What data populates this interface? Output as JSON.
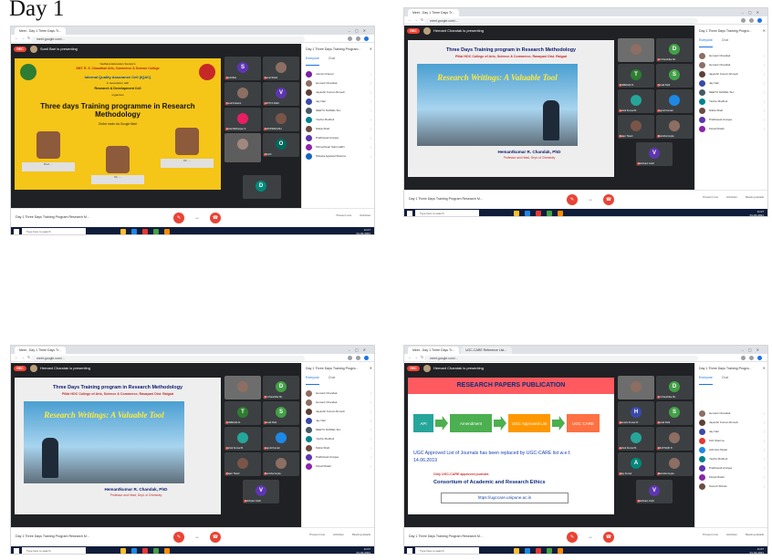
{
  "heading": "Day 1",
  "screens": [
    {
      "tabs": [
        "Meet - Day 1 Three Days Tr...",
        ""
      ],
      "url": "meet.google.com/...",
      "presenting": "Sunil Bari is presenting",
      "meeting_title": "Day 1 Three Days Training Program Research M...",
      "panel_title": "Day 1 Three Days Training Program...",
      "panel_tabs": [
        "Everyone",
        "Chat"
      ],
      "slide_kind": "poster",
      "slide": {
        "top_lines": [
          "Sadhana Education Society's",
          "SMT. R. S. Chaudhari Arts, Commerce & Science College",
          "Internal Quality Assurance Cell (IQAC)",
          "in association with",
          "Research & Development Cell",
          "organizes"
        ],
        "headline": "Three days Training programme in Research Methodology",
        "date_line": "Online mode via Google Meet",
        "speaker_captions": [
          "Prof. ...",
          "Dr. ...",
          "Dr. ..."
        ]
      },
      "tiles": [
        "Sunil Bari",
        "Sonal Shahi",
        "Kunal Kukarni",
        "UDITYA NAIK",
        "Anita Mukherjee S.",
        "SHIVPRAKASH",
        "",
        "Shubh"
      ],
      "participants": [
        "rukmini tharoor",
        "Hemant Chandak",
        "Jayashri Kumar Ahmedi",
        "Jay Nair",
        "NEETU DANIEL SH..",
        "Yashvi Mudholi",
        "Nikita Shah",
        "Prabhavati Arunjee",
        "Shiveshwari Samruddhi",
        "Shweta Agarwal Sharma"
      ]
    },
    {
      "tabs": [
        "Meet - Day 1 Three Days Tr...",
        ""
      ],
      "url": "meet.google.com/...",
      "presenting": "Hemant Chandak is presenting",
      "meeting_title": "Day 1 Three Days Training Program Research M...",
      "panel_title": "Day 1 Three Days Training Progra...",
      "panel_tabs": [
        "Everyone",
        "Chat"
      ],
      "slide_kind": "research",
      "slide": {
        "title": "Three Days Training program in Research Methodology",
        "subtitle": "Pillai HOC College of Arts, Science & Commerce, Rasayani Dist. Raigad",
        "image_text": "Research Writings: A Valuable Tool",
        "presenter": "Hemantkumar R. Chandak, PhD",
        "presenter_sub": "Professor and Head, Dept. of Chemistry"
      },
      "tiles": [
        "",
        "Dr.Chandrika Sh..",
        "SUREKHA N..",
        "Sonali Patil",
        "Ashok Kumar B.",
        "Jagruti Kumari",
        "Rajan Tiwari",
        "Manisha Gupta",
        "Vaishnavi Joshi"
      ],
      "participants": [
        "Hemant Chandak",
        "Hemant Chandak",
        "Jayashri Kumar Ahmedi",
        "Jay Nair",
        "NEETU DANIEL SH..",
        "Yashvi Mudholi",
        "Nikita Shah",
        "Prabhavati Arunjee",
        "Kirpal Mutah"
      ]
    },
    {
      "tabs": [
        "Meet - Day 1 Three Days Tr...",
        ""
      ],
      "url": "meet.google.com/...",
      "presenting": "Hemant Chandak is presenting",
      "meeting_title": "Day 1 Three Days Training Program Research M...",
      "panel_title": "Day 1 Three Days Training Progra...",
      "panel_tabs": [
        "Everyone",
        "Chat"
      ],
      "slide_kind": "research",
      "slide": {
        "title": "Three Days Training program in Research Methodology",
        "subtitle": "Pillai HOC College of Arts, Science & Commerce, Rasayani Dist. Raigad",
        "image_text": "Research Writings: A Valuable Tool",
        "presenter": "Hemantkumar R. Chandak, PhD",
        "presenter_sub": "Professor and Head, Dept. of Chemistry"
      },
      "tiles": [
        "",
        "Dr.Chandrika Sh..",
        "SUREKHA N..",
        "Sonali Patil",
        "Ashok Kumar B.",
        "Jagruti Kumari",
        "Rajan Tiwari",
        "Manisha Gupta",
        "Vaishnavi Joshi"
      ],
      "participants": [
        "Hemant Chandak",
        "Hemant Chandak",
        "Jayashri Kumar Ahmedi",
        "Jay Nair",
        "NEETU DANIEL SH..",
        "Yashvi Mudholi",
        "Nikita Shah",
        "Prabhavati Arunjee",
        "Kirpal Mutah"
      ]
    },
    {
      "tabs": [
        "Meet - Day 1 Three Days Tr...",
        "UGC-CARE Reference List..."
      ],
      "url": "meet.google.com/...",
      "presenting": "Hemant Chandak is presenting",
      "meeting_title": "Day 1 Three Days Training Program Research M...",
      "panel_title": "Day 1 Three Days Training Progra...",
      "panel_tabs": [
        "Everyone",
        "Chat"
      ],
      "slide_kind": "publication",
      "slide": {
        "header": "RESEARCH PAPERS PUBLICATION",
        "boxes": [
          "API",
          "Amendment",
          "UGC Approved List",
          "UGC CARE"
        ],
        "line1": "UGC Approved List of Journals has been replaced by UGC-CARE list w.e.f.",
        "line2": "14.06.2019",
        "small": "Only UGC-CARE approved journals",
        "consortium": "Consortium of Academic and Research Ethics",
        "link": "https://ugccare.unipune.ac.in"
      },
      "tiles": [
        "",
        "Dr.Chandrika Sh..",
        "Hemant Kumar R..",
        "Sonali Patil",
        "Ashok Kumar B..",
        "DILIP NAIK P..",
        "Ajay Kumar",
        "Manisha Gupta",
        "Vaishnavi Joshi"
      ],
      "participants": [
        "Hemant Chandak",
        "Jayashri Kumar Ahmedi",
        "Jay Nair",
        "Kirti Sharma",
        "Ashmita Pawar",
        "Yashvi Mudholi",
        "Prabhavati Arunjee",
        "Kirpal Mutah",
        "Suresh Shinde"
      ]
    }
  ],
  "meet_controls": [
    "mic-off",
    "present",
    "end-call"
  ],
  "meet_right": [
    "Present now",
    "Raise hand",
    "Activities",
    "Meeting details"
  ],
  "taskbar": {
    "search_placeholder": "Type here to search",
    "time": "11:07",
    "date": "01-02-2021"
  },
  "colors": {
    "meet_dark": "#202124",
    "accent_red": "#ea4335",
    "google_blue": "#1a73e8",
    "slide_yellow": "#f5c518",
    "taskbar": "#101d3a"
  }
}
